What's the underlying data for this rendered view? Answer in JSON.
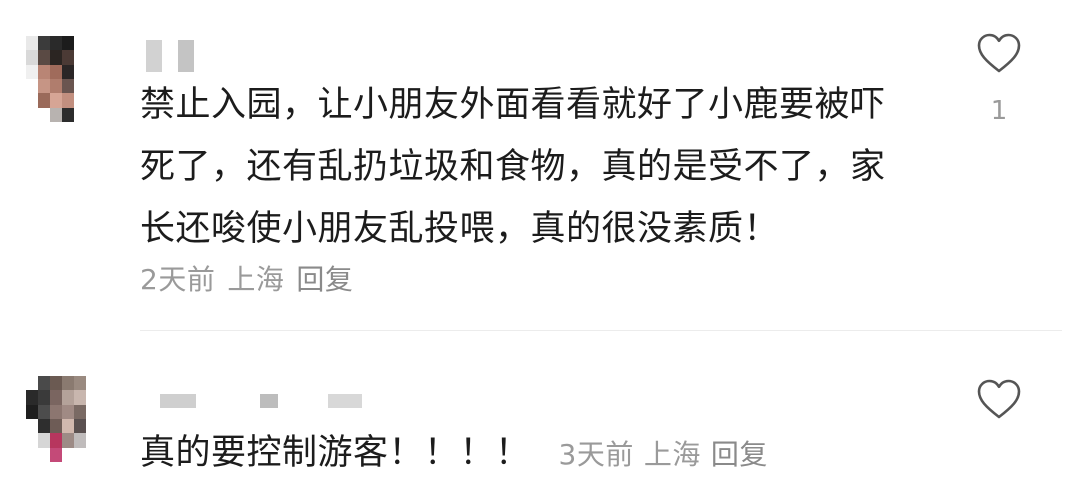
{
  "comments": [
    {
      "text": "禁止入园，让小朋友外面看看就好了小鹿要被吓死了，还有乱扔垃圾和食物，真的是受不了，家长还唆使小朋友乱投喂，真的很没素质！",
      "time": "2天前",
      "location": "上海",
      "reply_label": "回复",
      "like_count": "1",
      "like_icon": "heart-outline-icon"
    },
    {
      "text": "真的要控制游客！！！！",
      "time": "3天前",
      "location": "上海",
      "reply_label": "回复",
      "like_count": "",
      "like_icon": "heart-outline-icon"
    }
  ]
}
